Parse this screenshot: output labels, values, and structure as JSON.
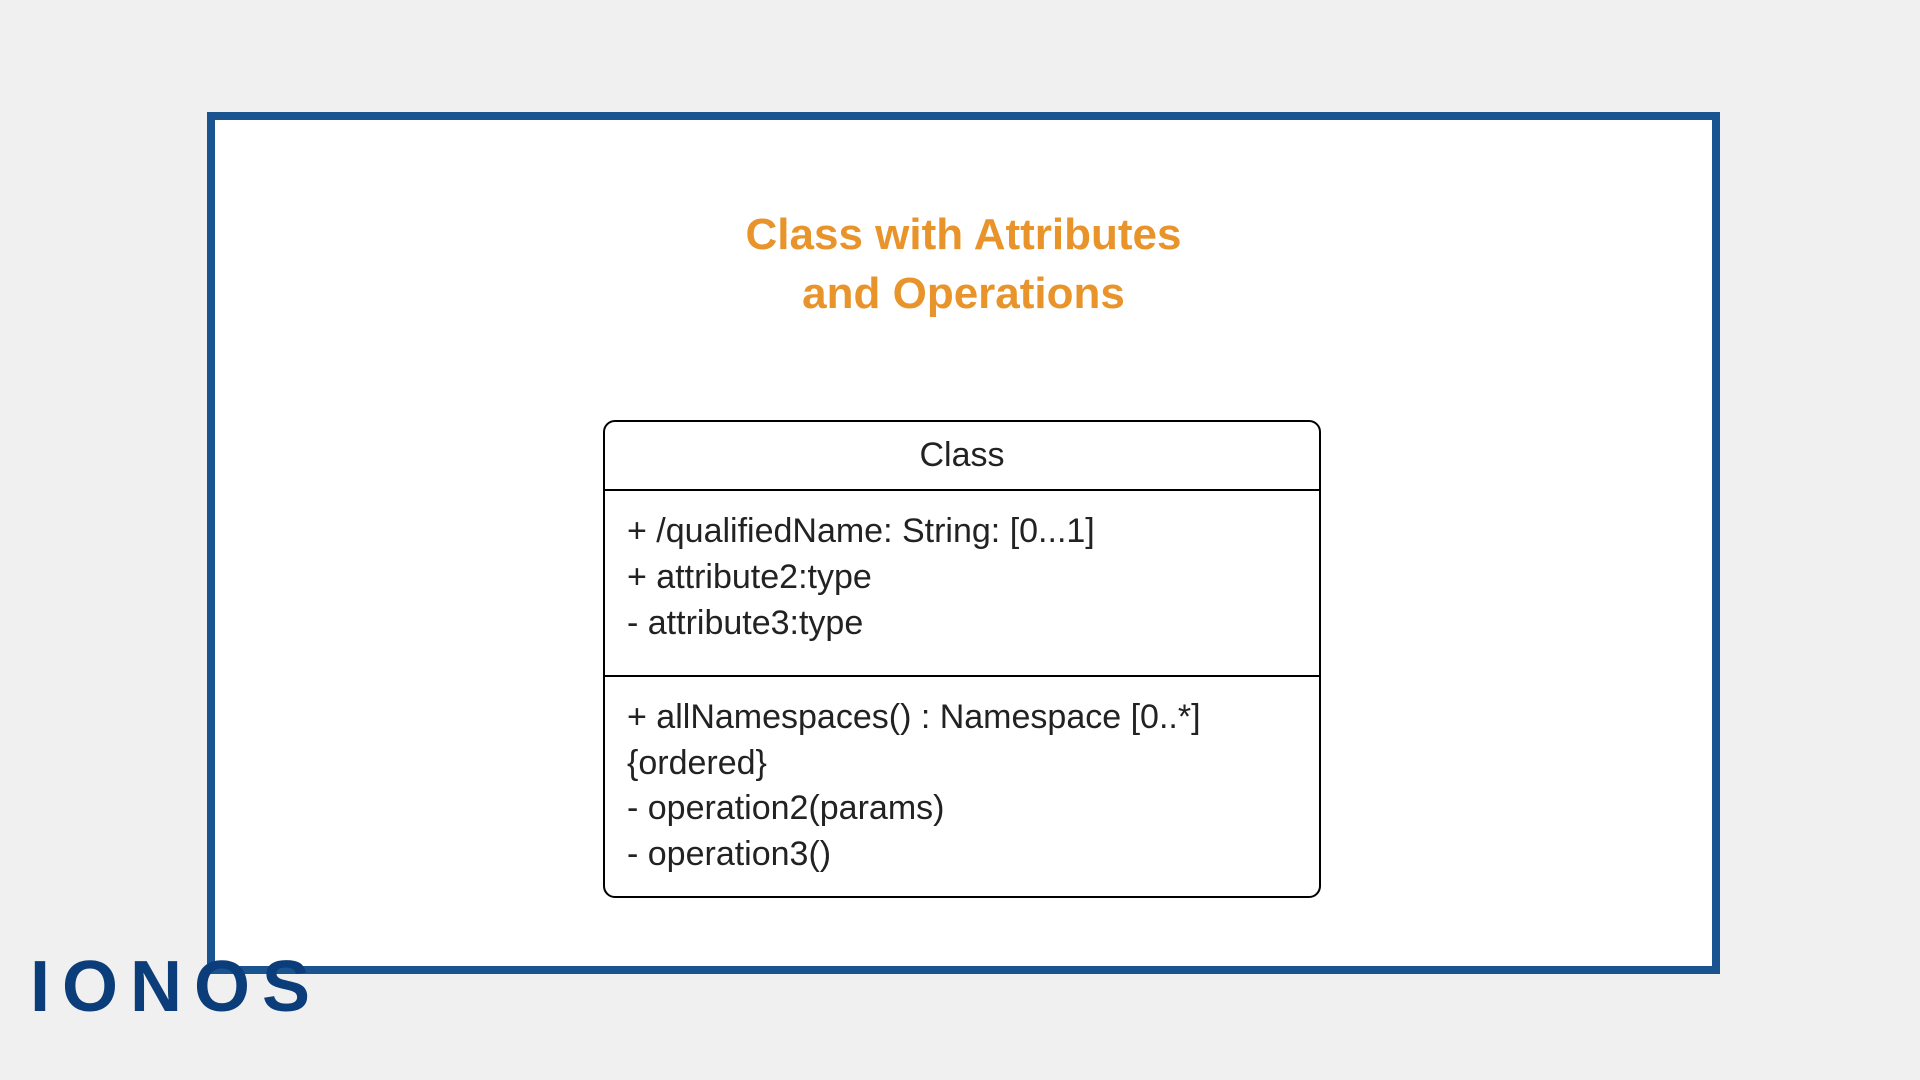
{
  "title_line1": "Class with Attributes",
  "title_line2": "and Operations",
  "uml": {
    "class_name": "Class",
    "attributes": [
      "+ /qualifiedName: String: [0...1]",
      "+ attribute2:type",
      "- attribute3:type"
    ],
    "operations": [
      "+ allNamespaces() : Namespace [0..*] {ordered}",
      "- operation2(params)",
      "- operation3()"
    ]
  },
  "logo": "IONOS"
}
